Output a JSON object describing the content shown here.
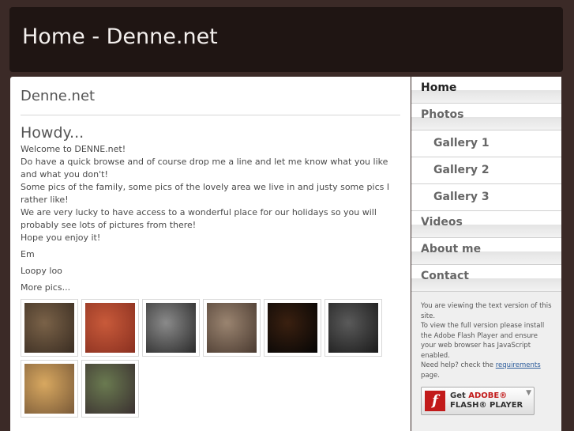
{
  "header": {
    "title": "Home - Denne.net"
  },
  "main": {
    "site_title": "Denne.net",
    "heading": "Howdy...",
    "lines": [
      "Welcome to DENNE.net!",
      "Do have a quick browse and of course drop me a line and let me know what you like and what you don't!",
      "Some pics of the family, some pics of the lovely area we live in and justy some pics I rather like!",
      "We are very lucky to have access to a wonderful place for our holidays so you will probably see lots of pictures from there!",
      "Hope you enjoy it!"
    ],
    "sign1": "Em",
    "sign2": "Loopy loo",
    "more_pics": "More pics...",
    "thumbnails": [
      {
        "colors": [
          "#7a6248",
          "#3a2d22"
        ]
      },
      {
        "colors": [
          "#c85a3a",
          "#8a3020"
        ]
      },
      {
        "colors": [
          "#8a8a8a",
          "#2a2a2a"
        ]
      },
      {
        "colors": [
          "#9a8470",
          "#4a3a30"
        ]
      },
      {
        "colors": [
          "#3a2010",
          "#050505"
        ]
      },
      {
        "colors": [
          "#5a5a5a",
          "#1a1a1a"
        ]
      },
      {
        "colors": [
          "#d8a860",
          "#7a5a38"
        ]
      },
      {
        "colors": [
          "#6a7a50",
          "#3a3030"
        ]
      }
    ]
  },
  "sidebar": {
    "nav": [
      {
        "label": "Home",
        "active": true,
        "sub": false
      },
      {
        "label": "Photos",
        "active": false,
        "sub": false
      },
      {
        "label": "Gallery 1",
        "active": false,
        "sub": true
      },
      {
        "label": "Gallery 2",
        "active": false,
        "sub": true
      },
      {
        "label": "Gallery 3",
        "active": false,
        "sub": true
      },
      {
        "label": "Videos",
        "active": false,
        "sub": false
      },
      {
        "label": "About me",
        "active": false,
        "sub": false
      },
      {
        "label": "Contact",
        "active": false,
        "sub": false
      }
    ],
    "flash_note_1": "You are viewing the text version of this site.",
    "flash_note_2": "To view the full version please install the Adobe Flash Player and ensure your web browser has JavaScript enabled.",
    "flash_help_prefix": "Need help? check the",
    "flash_help_link": "requirements",
    "flash_help_suffix": "page.",
    "flash_badge_get": "Get",
    "flash_badge_adobe": "ADOBE®",
    "flash_badge_player": "FLASH® PLAYER",
    "flash_logo_glyph": "f"
  }
}
